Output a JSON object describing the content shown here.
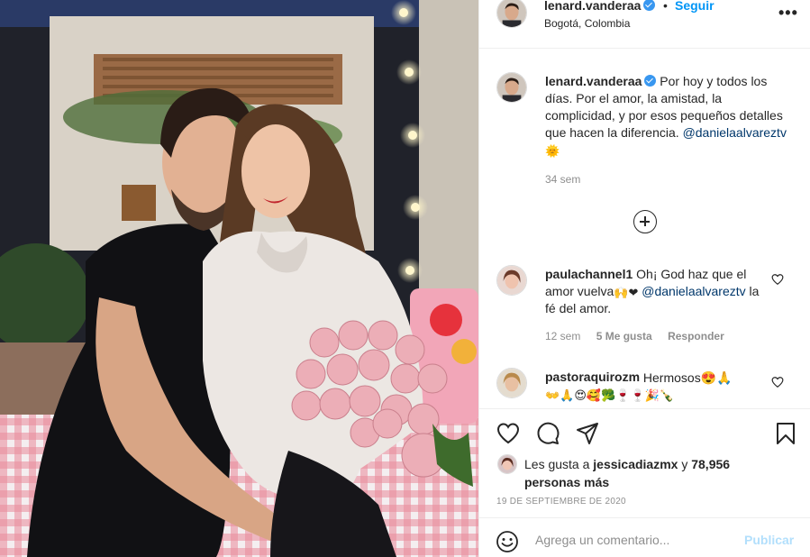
{
  "header": {
    "username": "lenard.vanderaa",
    "separator": "•",
    "follow_label": "Seguir",
    "location": "Bogotá, Colombia",
    "more_label": "•••"
  },
  "caption": {
    "username": "lenard.vanderaa",
    "text": "Por hoy y todos los días. Por el amor, la amistad, la complicidad, y por esos pequeños detalles que hacen la diferencia.",
    "mention": "@danielaalvareztv",
    "emoji": "🌞",
    "time": "34 sem"
  },
  "load_more_icon": "plus-circle-icon",
  "comments": [
    {
      "username": "paulachannel1",
      "text_1": "Oh¡ God haz que el amor vuelva",
      "emojis": "🙌❤",
      "mention": "@danielaalvareztv",
      "text_2": "la fé del amor.",
      "time": "12 sem",
      "likes": "5 Me gusta",
      "reply": "Responder"
    },
    {
      "username": "pastoraquirozm",
      "text_1": "Hermosos😍🙏",
      "emojis_2": "👐🙏😍🥰🥦🍷🍷🎉🍾"
    }
  ],
  "actions": {
    "like_icon": "heart-icon",
    "comment_icon": "comment-icon",
    "share_icon": "share-icon",
    "save_icon": "bookmark-icon"
  },
  "likes": {
    "prefix": "Les gusta a",
    "user": "jessicadiazmx",
    "conj": "y",
    "others": "78,956 personas más"
  },
  "date": "19 de septiembre de 2020",
  "add_comment": {
    "placeholder": "Agrega un comentario...",
    "publish_label": "Publicar",
    "emoji_icon": "smiley-icon"
  },
  "colors": {
    "link_blue": "#0095f6",
    "verified_blue": "#3897f0",
    "mention": "#00376b",
    "muted": "#8e8e8e",
    "publish_disabled": "#b2dffc"
  }
}
